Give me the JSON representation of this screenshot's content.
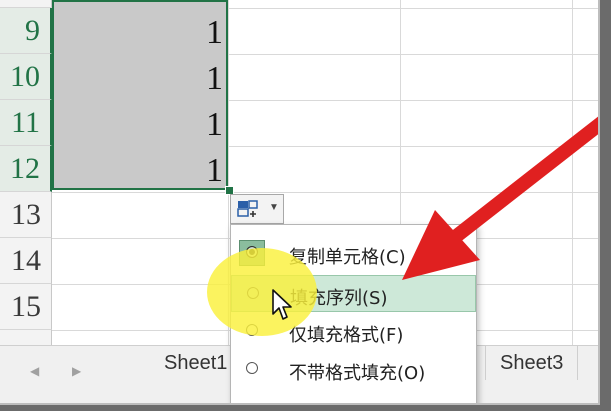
{
  "rows": [
    {
      "num": "9",
      "value": "1"
    },
    {
      "num": "10",
      "value": "1"
    },
    {
      "num": "11",
      "value": "1"
    },
    {
      "num": "12",
      "value": "1"
    },
    {
      "num": "13",
      "value": ""
    },
    {
      "num": "14",
      "value": ""
    },
    {
      "num": "15",
      "value": ""
    }
  ],
  "autofill_menu": {
    "items": [
      {
        "label": "复制单元格(C)",
        "state": "selected"
      },
      {
        "label": "填充序列(S)",
        "state": "hovered"
      },
      {
        "label": "仅填充格式(F)",
        "state": "normal"
      },
      {
        "label": "不带格式填充(O)",
        "state": "normal"
      }
    ]
  },
  "sheet_tabs": [
    {
      "label": "Sheet1",
      "active": false
    },
    {
      "label": "Sheet3",
      "active": false
    }
  ],
  "colors": {
    "excel_green": "#217346",
    "annotation_red": "#e02020",
    "highlight_yellow": "#f5ec3a",
    "hover_green": "#cde8d8"
  },
  "icons": {
    "autofill": "autofill-options-icon",
    "dropdown": "chevron-down-icon",
    "cursor": "mouse-pointer-icon",
    "annotation": "red-arrow-annotation"
  }
}
